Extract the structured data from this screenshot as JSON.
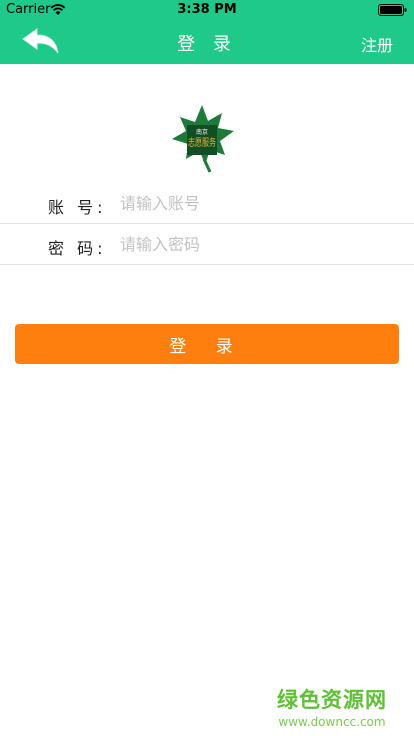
{
  "status_bar": {
    "carrier": "Carrier",
    "time": "3:38 PM"
  },
  "nav": {
    "title": "登 录",
    "register_label": "注册",
    "back_icon": "back-arrow-icon"
  },
  "logo": {
    "text_small": "南京",
    "text_main": "志愿服务"
  },
  "form": {
    "account_label": "账 号:",
    "account_placeholder": "请输入账号",
    "password_label": "密 码:",
    "password_placeholder": "请输入密码"
  },
  "login_button_label": "登 录",
  "watermark": {
    "name": "绿色资源网",
    "url": "www.downcc.com"
  },
  "colors": {
    "header": "#1ec98a",
    "button": "#ff7f0e",
    "watermark": "#5fc036"
  }
}
